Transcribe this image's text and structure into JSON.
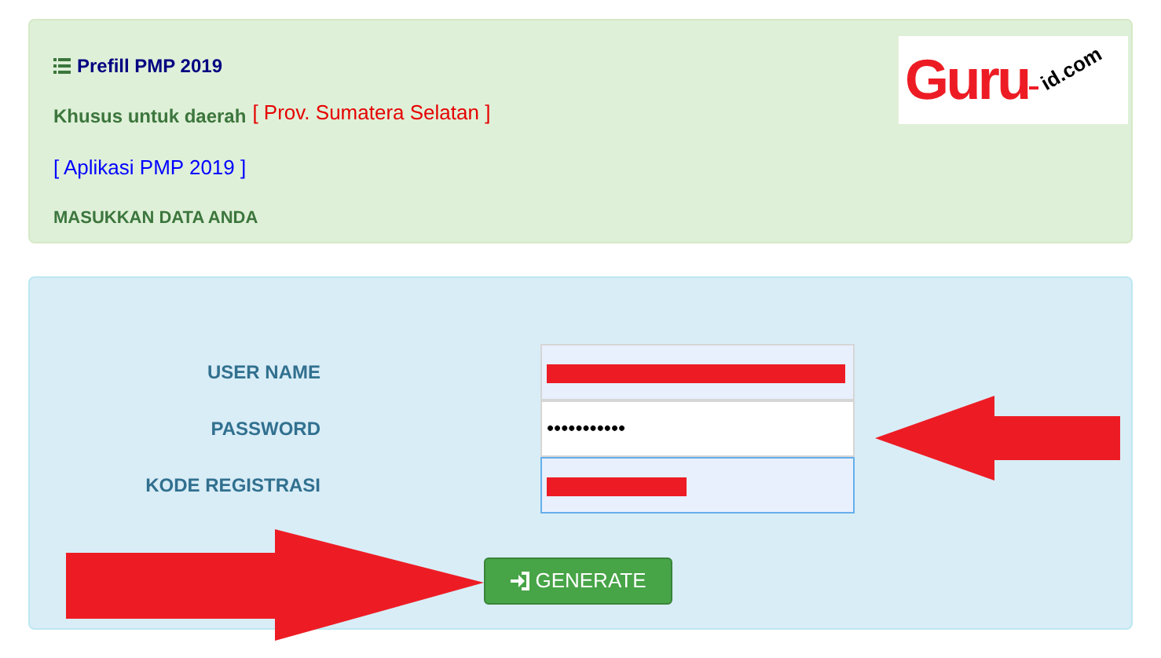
{
  "info_panel": {
    "title": "Prefill PMP 2019",
    "region_label": "Khusus untuk daerah",
    "region": "[ Prov. Sumatera Selatan ]",
    "app_label": "[ Aplikasi PMP 2019 ]",
    "instruction": "MASUKKAN DATA ANDA"
  },
  "logo": {
    "main": "Guru",
    "suffix": "id.com"
  },
  "form": {
    "fields": [
      {
        "label": "USER NAME",
        "kind": "redacted",
        "focused": false
      },
      {
        "label": "PASSWORD",
        "kind": "password",
        "value": "•••••••••••",
        "focused": false
      },
      {
        "label": "KODE REGISTRASI",
        "kind": "redacted",
        "focused": true
      }
    ],
    "button": "GENERATE"
  }
}
